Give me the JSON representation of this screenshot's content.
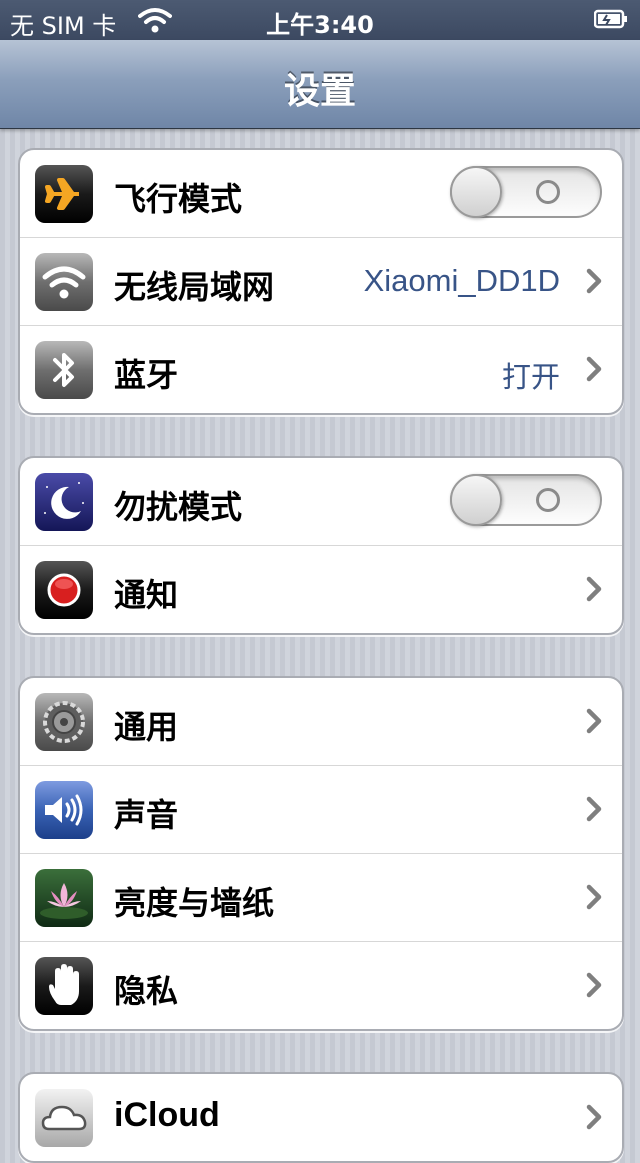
{
  "status_bar": {
    "carrier": "无 SIM 卡",
    "time": "上午3:40",
    "wifi_icon": "wifi-icon",
    "battery_icon": "battery-charging-icon"
  },
  "nav": {
    "title": "设置"
  },
  "groups": [
    {
      "rows": [
        {
          "label": "飞行模式",
          "icon": "airplane-icon",
          "toggle": "off"
        },
        {
          "label": "无线局域网",
          "icon": "wifi-icon",
          "value": "Xiaomi_DD1D"
        },
        {
          "label": "蓝牙",
          "icon": "bluetooth-icon",
          "value": "打开"
        }
      ]
    },
    {
      "rows": [
        {
          "label": "勿扰模式",
          "icon": "moon-icon",
          "toggle": "off"
        },
        {
          "label": "通知",
          "icon": "notifications-icon"
        }
      ]
    },
    {
      "rows": [
        {
          "label": "通用",
          "icon": "gear-icon"
        },
        {
          "label": "声音",
          "icon": "speaker-icon"
        },
        {
          "label": "亮度与墙纸",
          "icon": "wallpaper-flower-icon"
        },
        {
          "label": "隐私",
          "icon": "hand-icon"
        }
      ]
    },
    {
      "rows": [
        {
          "label": "iCloud",
          "icon": "cloud-icon"
        }
      ]
    }
  ],
  "colors": {
    "nav_bar": "#8b9fbb",
    "value_text": "#385487",
    "airplane_orange": "#f5a623",
    "notification_red": "#d81f1f",
    "sound_blue": "#3a63b5"
  }
}
